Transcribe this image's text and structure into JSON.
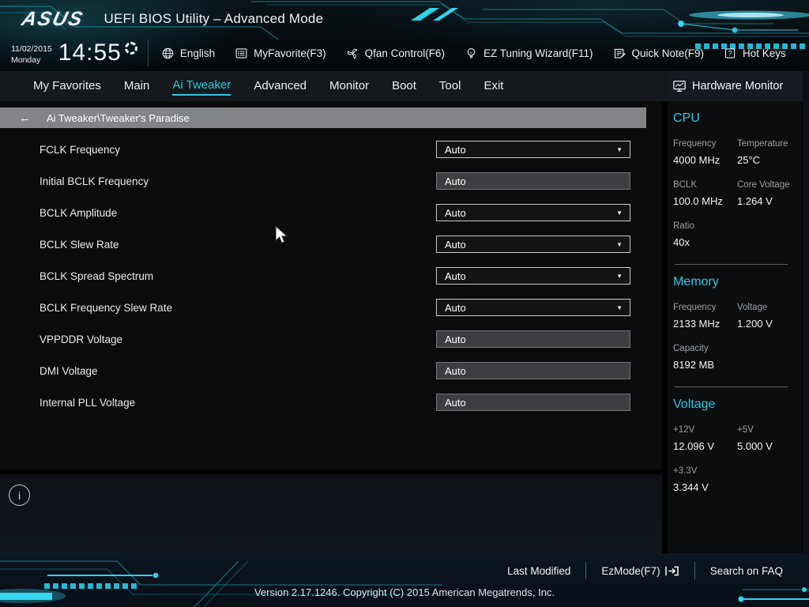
{
  "colors": {
    "accent_cyan": "#2fc7e1",
    "breadcrumb_gray": "#828487",
    "input_fill": "#3d3e41",
    "dropdown_fill": "#131314"
  },
  "header": {
    "logo": "ASUS",
    "title": "UEFI BIOS Utility – Advanced Mode"
  },
  "clock": {
    "date": "11/02/2015",
    "day": "Monday",
    "time": "14:55"
  },
  "toolbar": [
    {
      "label": "English",
      "icon": "globe-icon"
    },
    {
      "label": "MyFavorite(F3)",
      "icon": "favorites-list-icon"
    },
    {
      "label": "Qfan Control(F6)",
      "icon": "fan-icon"
    },
    {
      "label": "EZ Tuning Wizard(F11)",
      "icon": "lightbulb-icon"
    },
    {
      "label": "Quick Note(F9)",
      "icon": "note-icon"
    },
    {
      "label": "Hot Keys",
      "icon": "question-icon"
    }
  ],
  "nav": {
    "tabs": [
      "My Favorites",
      "Main",
      "Ai Tweaker",
      "Advanced",
      "Monitor",
      "Boot",
      "Tool",
      "Exit"
    ],
    "active": "Ai Tweaker"
  },
  "breadcrumb": {
    "back_icon": "←",
    "path": "Ai Tweaker\\Tweaker's Paradise"
  },
  "settings": [
    {
      "label": "FCLK Frequency",
      "value": "Auto",
      "control": "dropdown"
    },
    {
      "label": "Initial BCLK Frequency",
      "value": "Auto",
      "control": "input"
    },
    {
      "label": "BCLK Amplitude",
      "value": "Auto",
      "control": "dropdown"
    },
    {
      "label": "BCLK Slew Rate",
      "value": "Auto",
      "control": "dropdown"
    },
    {
      "label": "BCLK Spread Spectrum",
      "value": "Auto",
      "control": "dropdown"
    },
    {
      "label": "BCLK Frequency Slew Rate",
      "value": "Auto",
      "control": "dropdown"
    },
    {
      "label": "VPPDDR Voltage",
      "value": "Auto",
      "control": "input"
    },
    {
      "label": "DMI Voltage",
      "value": "Auto",
      "control": "input"
    },
    {
      "label": "Internal PLL Voltage",
      "value": "Auto",
      "control": "input"
    }
  ],
  "hardware_monitor": {
    "title": "Hardware Monitor",
    "sections": [
      {
        "title": "CPU",
        "metrics": [
          {
            "label": "Frequency",
            "value": "4000 MHz"
          },
          {
            "label": "Temperature",
            "value": "25°C"
          },
          {
            "label": "BCLK",
            "value": "100.0 MHz"
          },
          {
            "label": "Core Voltage",
            "value": "1.264 V"
          },
          {
            "label": "Ratio",
            "value": "40x"
          }
        ]
      },
      {
        "title": "Memory",
        "metrics": [
          {
            "label": "Frequency",
            "value": "2133 MHz"
          },
          {
            "label": "Voltage",
            "value": "1.200 V"
          },
          {
            "label": "Capacity",
            "value": "8192 MB"
          }
        ]
      },
      {
        "title": "Voltage",
        "metrics": [
          {
            "label": "+12V",
            "value": "12.096 V"
          },
          {
            "label": "+5V",
            "value": "5.000 V"
          },
          {
            "label": "+3.3V",
            "value": "3.344 V"
          }
        ]
      }
    ]
  },
  "info_icon_glyph": "i",
  "footer": {
    "links": [
      {
        "label": "Last Modified"
      },
      {
        "label": "EzMode(F7)",
        "icon": "ezmode-exit-icon"
      },
      {
        "label": "Search on FAQ"
      }
    ],
    "version": "Version 2.17.1246. Copyright (C) 2015 American Megatrends, Inc."
  }
}
